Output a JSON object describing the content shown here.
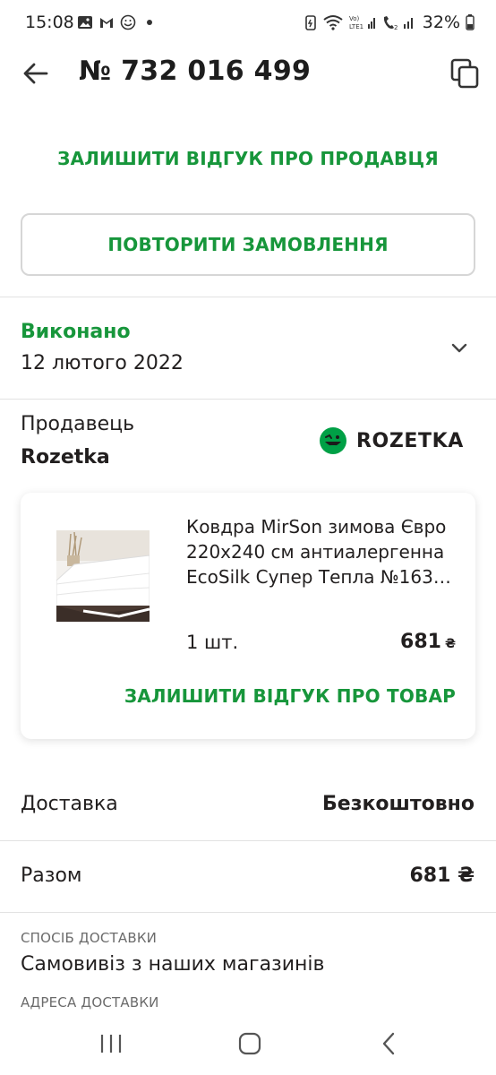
{
  "status_bar": {
    "time": "15:08",
    "battery": "32%"
  },
  "header": {
    "order_number": "№ 732 016 499"
  },
  "actions": {
    "review_seller": "ЗАЛИШИТИ ВІДГУК ПРО ПРОДАВЦЯ",
    "repeat_order": "ПОВТОРИТИ ЗАМОВЛЕННЯ"
  },
  "order_status": {
    "status": "Виконано",
    "date": "12 лютого 2022"
  },
  "seller": {
    "label": "Продавець",
    "name": "Rozetka",
    "logo_text": "ROZETKA"
  },
  "product": {
    "title": "Ковдра MirSon зимова Євро 220х240 см антиалергенна EcoSilk Супер Тепла №163…",
    "quantity": "1 шт.",
    "price": "681",
    "currency": "₴",
    "review_label": "ЗАЛИШИТИ ВІДГУК ПРО ТОВАР"
  },
  "summary": {
    "delivery_label": "Доставка",
    "delivery_value": "Безкоштовно",
    "total_label": "Разом",
    "total_value": "681 ₴"
  },
  "delivery_info": {
    "method_caption": "СПОСІБ ДОСТАВКИ",
    "method_value": "Самовивіз з наших магазинів",
    "address_caption": "АДРЕСА ДОСТАВКИ"
  },
  "colors": {
    "accent_green": "#17963b",
    "text": "#221f1f",
    "divider": "#e2e2e2"
  },
  "icons": [
    "back-arrow-icon",
    "copy-icon",
    "chevron-down-icon",
    "rozetka-logo-icon",
    "nav-recent-icon",
    "nav-home-icon",
    "nav-back-icon"
  ]
}
